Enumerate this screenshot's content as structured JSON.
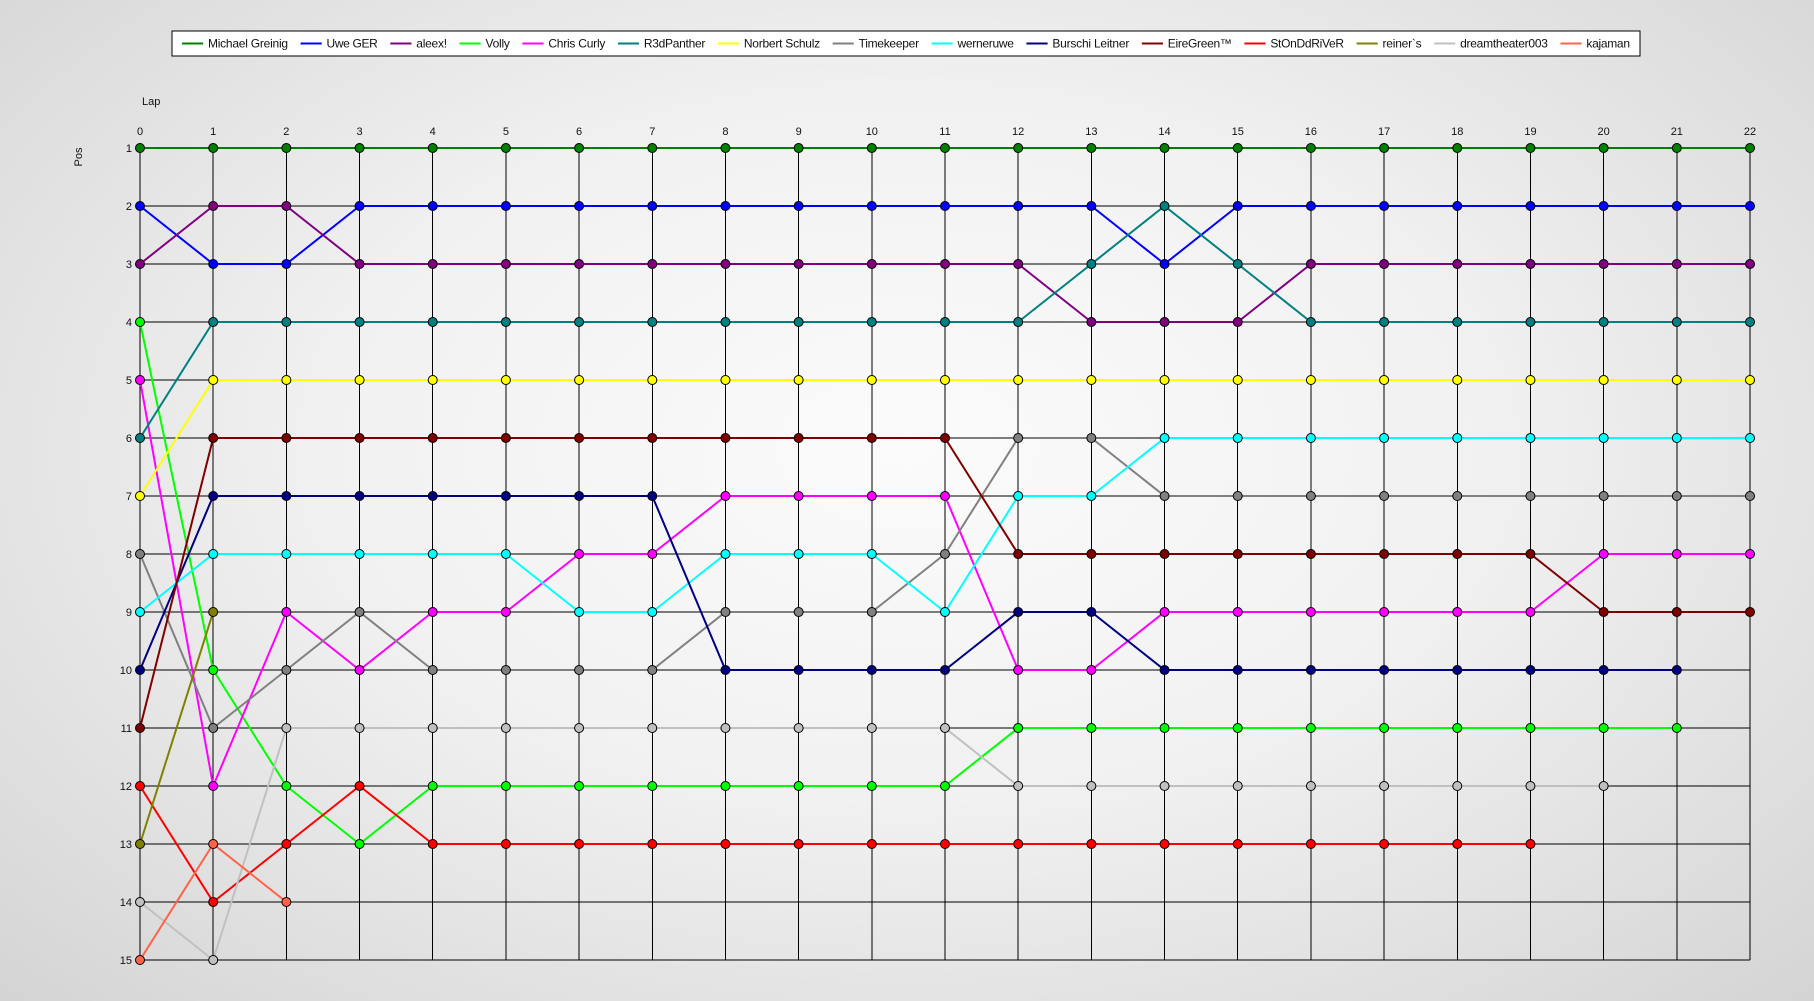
{
  "chart_data": {
    "type": "line",
    "title": "",
    "xlabel": "Lap",
    "ylabel": "Pos",
    "x": [
      0,
      1,
      2,
      3,
      4,
      5,
      6,
      7,
      8,
      9,
      10,
      11,
      12,
      13,
      14,
      15,
      16,
      17,
      18,
      19,
      20,
      21,
      22
    ],
    "xlim": [
      0,
      22
    ],
    "ylim": [
      1,
      15
    ],
    "y_inverted": true,
    "grid": true,
    "legend": "top",
    "series": [
      {
        "name": "Michael Greinig",
        "color": "#008000",
        "values": [
          1,
          1,
          1,
          1,
          1,
          1,
          1,
          1,
          1,
          1,
          1,
          1,
          1,
          1,
          1,
          1,
          1,
          1,
          1,
          1,
          1,
          1,
          1
        ]
      },
      {
        "name": "Uwe GER",
        "color": "#0000FF",
        "values": [
          2,
          3,
          3,
          2,
          2,
          2,
          2,
          2,
          2,
          2,
          2,
          2,
          2,
          2,
          3,
          2,
          2,
          2,
          2,
          2,
          2,
          2,
          2
        ]
      },
      {
        "name": "aleex!",
        "color": "#800080",
        "values": [
          3,
          2,
          2,
          3,
          3,
          3,
          3,
          3,
          3,
          3,
          3,
          3,
          3,
          4,
          4,
          4,
          3,
          3,
          3,
          3,
          3,
          3,
          3
        ]
      },
      {
        "name": "Volly",
        "color": "#00FF00",
        "values": [
          4,
          10,
          12,
          13,
          12,
          12,
          12,
          12,
          12,
          12,
          12,
          12,
          11,
          11,
          11,
          11,
          11,
          11,
          11,
          11,
          11,
          11,
          null
        ]
      },
      {
        "name": "Chris Curly",
        "color": "#FF00FF",
        "values": [
          5,
          12,
          9,
          10,
          9,
          9,
          8,
          8,
          7,
          7,
          7,
          7,
          10,
          10,
          9,
          9,
          9,
          9,
          9,
          9,
          8,
          8,
          8
        ]
      },
      {
        "name": "R3dPanther",
        "color": "#008080",
        "values": [
          6,
          4,
          4,
          4,
          4,
          4,
          4,
          4,
          4,
          4,
          4,
          4,
          4,
          3,
          2,
          3,
          4,
          4,
          4,
          4,
          4,
          4,
          4
        ]
      },
      {
        "name": "Norbert Schulz",
        "color": "#FFFF00",
        "values": [
          7,
          5,
          5,
          5,
          5,
          5,
          5,
          5,
          5,
          5,
          5,
          5,
          5,
          5,
          5,
          5,
          5,
          5,
          5,
          5,
          5,
          5,
          5
        ]
      },
      {
        "name": "Timekeeper",
        "color": "#808080",
        "values": [
          8,
          11,
          10,
          9,
          10,
          10,
          10,
          10,
          9,
          9,
          9,
          8,
          6,
          6,
          7,
          7,
          7,
          7,
          7,
          7,
          7,
          7,
          7
        ]
      },
      {
        "name": "werneruwe",
        "color": "#00FFFF",
        "values": [
          9,
          8,
          8,
          8,
          8,
          8,
          9,
          9,
          8,
          8,
          8,
          9,
          7,
          7,
          6,
          6,
          6,
          6,
          6,
          6,
          6,
          6,
          6
        ]
      },
      {
        "name": "Burschi Leitner",
        "color": "#000080",
        "values": [
          10,
          7,
          7,
          7,
          7,
          7,
          7,
          7,
          10,
          10,
          10,
          10,
          9,
          9,
          10,
          10,
          10,
          10,
          10,
          10,
          10,
          10,
          null
        ]
      },
      {
        "name": "EireGreen™",
        "color": "#800000",
        "values": [
          11,
          6,
          6,
          6,
          6,
          6,
          6,
          6,
          6,
          6,
          6,
          6,
          8,
          8,
          8,
          8,
          8,
          8,
          8,
          8,
          9,
          9,
          9
        ]
      },
      {
        "name": "StOnDdRiVeR",
        "color": "#FF0000",
        "values": [
          12,
          14,
          13,
          12,
          13,
          13,
          13,
          13,
          13,
          13,
          13,
          13,
          13,
          13,
          13,
          13,
          13,
          13,
          13,
          13,
          null,
          null,
          null
        ]
      },
      {
        "name": "reiner`s",
        "color": "#808000",
        "values": [
          13,
          9,
          null,
          null,
          null,
          null,
          null,
          null,
          null,
          null,
          null,
          null,
          null,
          null,
          null,
          null,
          null,
          null,
          null,
          null,
          null,
          null,
          null
        ]
      },
      {
        "name": "dreamtheater003",
        "color": "#C0C0C0",
        "values": [
          14,
          15,
          11,
          11,
          11,
          11,
          11,
          11,
          11,
          11,
          11,
          11,
          12,
          12,
          12,
          12,
          12,
          12,
          12,
          12,
          12,
          null,
          null
        ]
      },
      {
        "name": "kajaman",
        "color": "#FF6347",
        "values": [
          15,
          13,
          14,
          null,
          null,
          null,
          null,
          null,
          null,
          null,
          null,
          null,
          null,
          null,
          null,
          null,
          null,
          null,
          null,
          null,
          null,
          null,
          null
        ]
      }
    ]
  }
}
